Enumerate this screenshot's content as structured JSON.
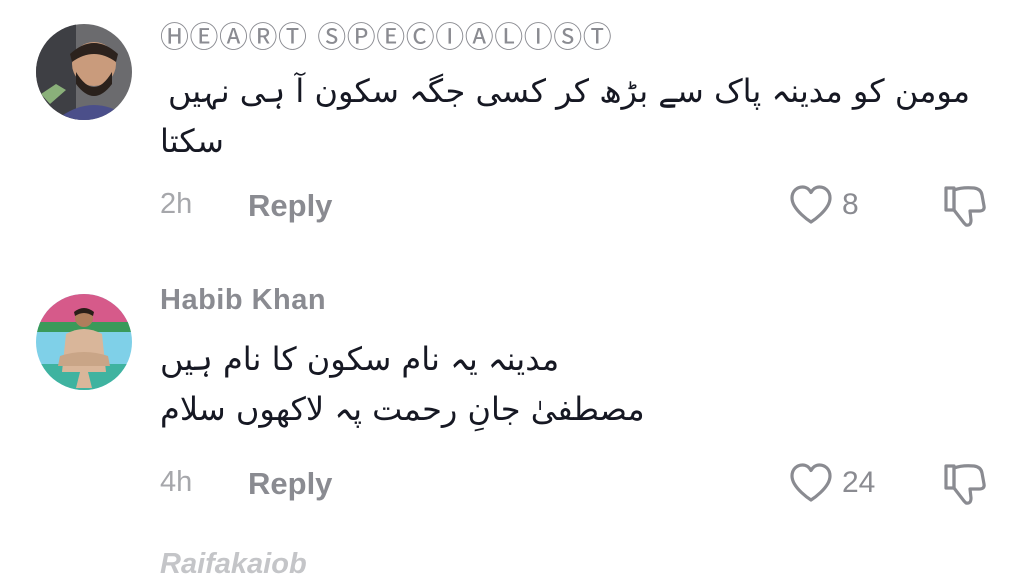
{
  "comments": [
    {
      "username": "ⒽⒺⒶⓇⓉ ⓈⓅⒺⒸⒾⒶⓁⒾⓈⓉ",
      "text_lines": [
        "مومن کو مدینہ پاک سے بڑھ کر کسی جگہ سکون آ ہی نہیں",
        "سکتا"
      ],
      "time": "2h",
      "reply_label": "Reply",
      "likes": "8"
    },
    {
      "username": "Habib Khan",
      "text_lines": [
        "مدینہ یہ نام سکون کا نام ہیں",
        "مصطفیٰ جانِ رحمت پہ لاکھوں سلام"
      ],
      "time": "4h",
      "reply_label": "Reply",
      "likes": "24"
    }
  ],
  "next_comment": {
    "username": "Raifakaiob"
  },
  "icons": {
    "like": "heart-outline-icon",
    "dislike": "thumbs-down-outline-icon"
  },
  "colors": {
    "muted": "#8a8b91",
    "text": "#161823"
  }
}
